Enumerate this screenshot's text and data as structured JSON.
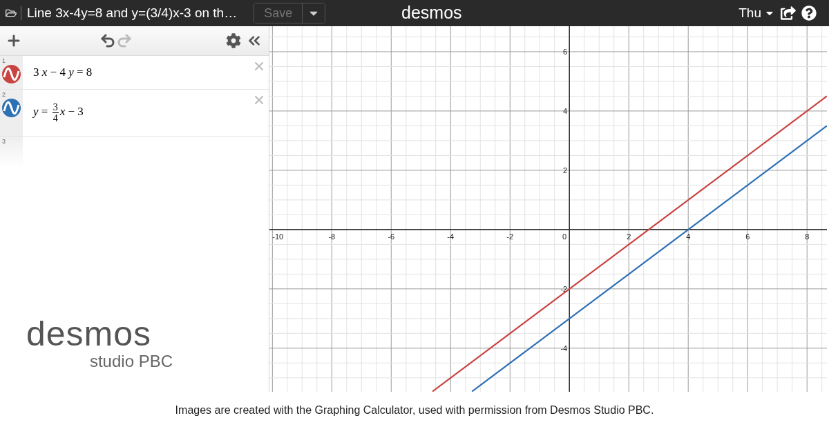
{
  "window": {
    "title": "Line 3x-4y=8 and y=(3/4)x-3 on th…"
  },
  "toolbar": {
    "save_label": "Save",
    "save_disabled": true,
    "brand": "desmos",
    "user": "Thu"
  },
  "list_tools": {
    "undo_disabled": false,
    "redo_disabled": true
  },
  "expressions": [
    {
      "number": "1",
      "kind": "plain",
      "math": "3 *x* − 4 *y* = 8",
      "color": "#c74440"
    },
    {
      "number": "2",
      "kind": "fraction",
      "lhs": "*y* =",
      "numerator": "3",
      "denominator": "4",
      "rest": "*x* − 3",
      "color": "#2d70b3"
    },
    {
      "number": "3",
      "kind": "empty"
    }
  ],
  "logo": {
    "name": "desmos",
    "tagline": "studio PBC"
  },
  "graph": {
    "origin_label": "0",
    "chart_data": {
      "type": "line",
      "grid": true,
      "x": [
        -4.61,
        -3.28,
        8.67
      ],
      "series": [
        {
          "color": "#c74440",
          "values": [
            -5.46,
            null,
            4.5
          ]
        },
        {
          "color": "#2d70b3",
          "values": [
            null,
            -5.46,
            3.5
          ]
        }
      ],
      "xlim": [
        -10.1,
        8.67
      ],
      "ylim": [
        -5.47,
        6.86
      ],
      "xticks": [
        -10,
        -8,
        -6,
        -4,
        -2,
        2,
        4,
        6,
        8
      ],
      "yticks": [
        -4,
        -2,
        2,
        4,
        6
      ]
    }
  },
  "caption": "Images are created with the Graphing Calculator, used with permission from Desmos Studio PBC."
}
